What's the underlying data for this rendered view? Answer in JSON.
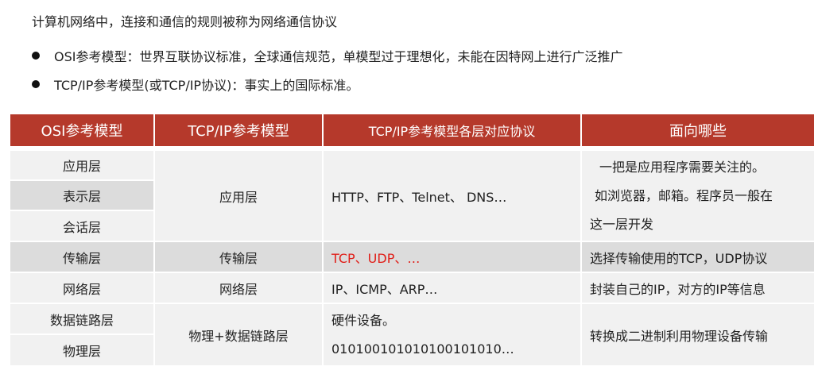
{
  "intro": "计算机网络中，连接和通信的规则被称为网络通信协议",
  "bullets": [
    "OSI参考模型：世界互联协议标准，全球通信规范，单模型过于理想化，未能在因特网上进行广泛推广",
    "TCP/IP参考模型(或TCP/IP协议)：事实上的国际标准。"
  ],
  "table": {
    "headers": [
      "OSI参考模型",
      "TCP/IP参考模型",
      "TCP/IP参考模型各层对应协议",
      "面向哪些"
    ],
    "osi": [
      "应用层",
      "表示层",
      "会话层",
      "传输层",
      "网络层",
      "数据链路层",
      "物理层"
    ],
    "tcpip": [
      "应用层",
      "传输层",
      "网络层",
      "物理+数据链路层"
    ],
    "protocols": [
      "HTTP、FTP、Telnet、 DNS…",
      "TCP、UDP、…",
      "IP、ICMP、ARP…",
      "硬件设备。",
      "010100101010100101010…"
    ],
    "notes": [
      "一把是应用程序需要关注的。",
      "如浏览器，邮箱。程序员一般在",
      "这一层开发",
      "选择传输使用的TCP，UDP协议",
      "封装自己的IP，对方的IP等信息",
      "转换成二进制利用物理设备传输"
    ]
  },
  "colors": {
    "header": "#b5392b",
    "highlight": "#e0201a"
  }
}
